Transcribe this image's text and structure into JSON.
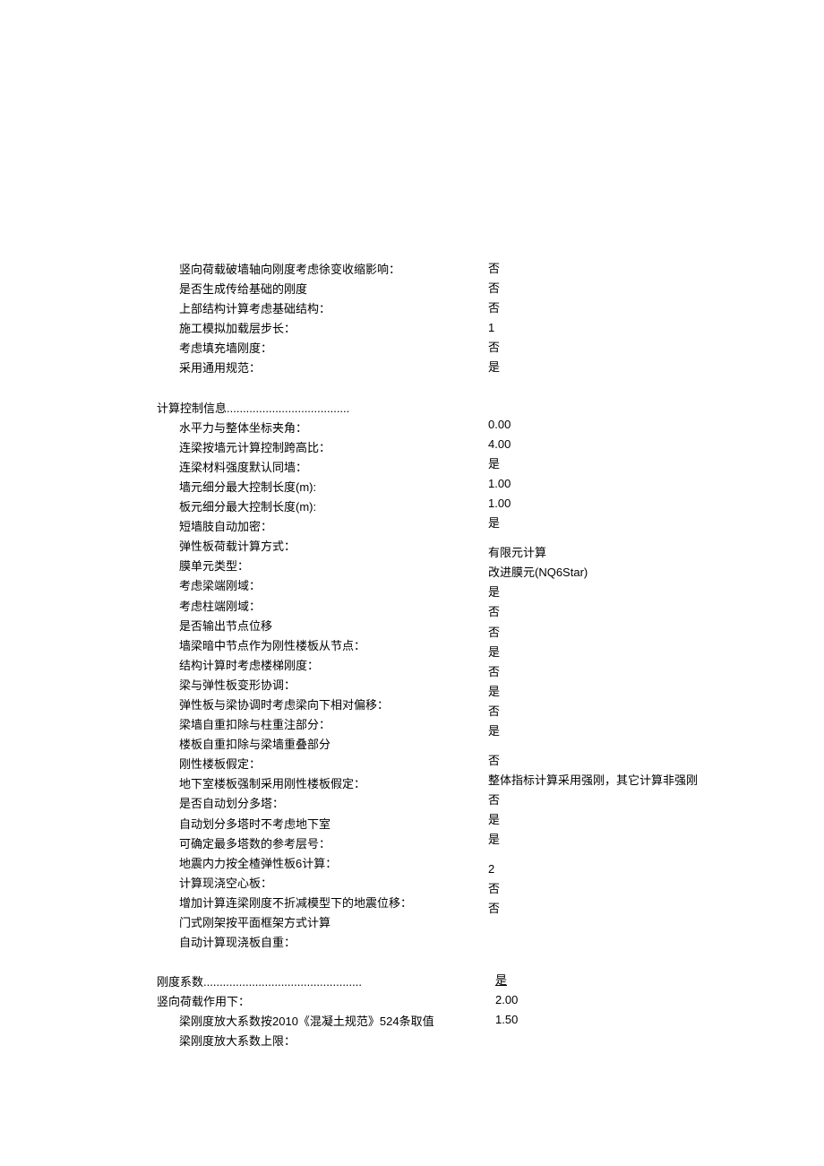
{
  "block1": {
    "items": [
      {
        "label": "竖向荷载破墙轴向刚度考虑徐变收缩影响：",
        "value": "否"
      },
      {
        "label": "是否生成传给基础的刚度",
        "value": "否"
      },
      {
        "label": "上部结构计算考虑基础结构：",
        "value": "否"
      },
      {
        "label": "施工模拟加载层步长：",
        "value": "1"
      },
      {
        "label": "考虑填充墙刚度：",
        "value": "否"
      },
      {
        "label": "采用通用规范：",
        "value": "是"
      }
    ]
  },
  "block2": {
    "header": "计算控制信息",
    "items": [
      {
        "label": "水平力与整体坐标夹角：",
        "value": "0.00"
      },
      {
        "label": "连梁按墙元计算控制跨高比：",
        "value": "4.00"
      },
      {
        "label": "连梁材料强度默认同墙：",
        "value": "是"
      },
      {
        "label": "墙元细分最大控制长度(m):",
        "value": "1.00"
      },
      {
        "label": "板元细分最大控制长度(m):",
        "value": "1.00"
      },
      {
        "label": "短墙肢自动加密：",
        "value": "是"
      },
      {
        "label": "弹性板荷载计算方式：",
        "value": "有限元计算"
      },
      {
        "label": "膜单元类型：",
        "value": "改进膜元(NQ6Star)"
      },
      {
        "label": "考虑梁端刚域：",
        "value": "是"
      },
      {
        "label": "考虑柱端刚域：",
        "value": "否"
      },
      {
        "label": "是否输出节点位移",
        "value": "否"
      },
      {
        "label": "墙梁暗中节点作为刚性楼板从节点：",
        "value": "是"
      },
      {
        "label": "结构计算时考虑楼梯刚度：",
        "value": "否"
      },
      {
        "label": "梁与弹性板变形协调：",
        "value": "是"
      },
      {
        "label": "弹性板与梁协调时考虑梁向下相对偏移：",
        "value": "否"
      },
      {
        "label": "梁墙自重扣除与柱重注部分：",
        "value": "是"
      },
      {
        "label": "楼板自重扣除与梁墙重叠部分",
        "value": "否"
      },
      {
        "label": "刚性楼板假定：",
        "value": "整体指标计算采用强刚，其它计算非强刚"
      },
      {
        "label": "地下室楼板强制采用刚性楼板假定：",
        "value": "否"
      },
      {
        "label": "是否自动划分多塔：",
        "value": "是"
      },
      {
        "label": "自动划分多塔时不考虑地下室",
        "value": "是"
      },
      {
        "label": "可确定最多塔数的参考层号：",
        "value": "2"
      },
      {
        "label": "地震内力按全楂弹性板6计算：",
        "value": "否"
      },
      {
        "label": "计算现浇空心板：",
        "value": "否"
      },
      {
        "label": "增加计算连梁刚度不折减模型下的地震位移：",
        "value": ""
      },
      {
        "label": "门式刚架按平面框架方式计算",
        "value": ""
      },
      {
        "label": "自动计算现浇板自重：",
        "value": ""
      }
    ]
  },
  "block3": {
    "header": "刚度系数",
    "line2": "竖向荷载作用下：",
    "items": [
      {
        "label": "梁刚度放大系数按2010《混凝土规范》524条取值",
        "value": ""
      },
      {
        "label": "梁刚度放大系数上限：",
        "value": ""
      }
    ],
    "values": [
      "是",
      "2.00",
      "1.50"
    ]
  }
}
